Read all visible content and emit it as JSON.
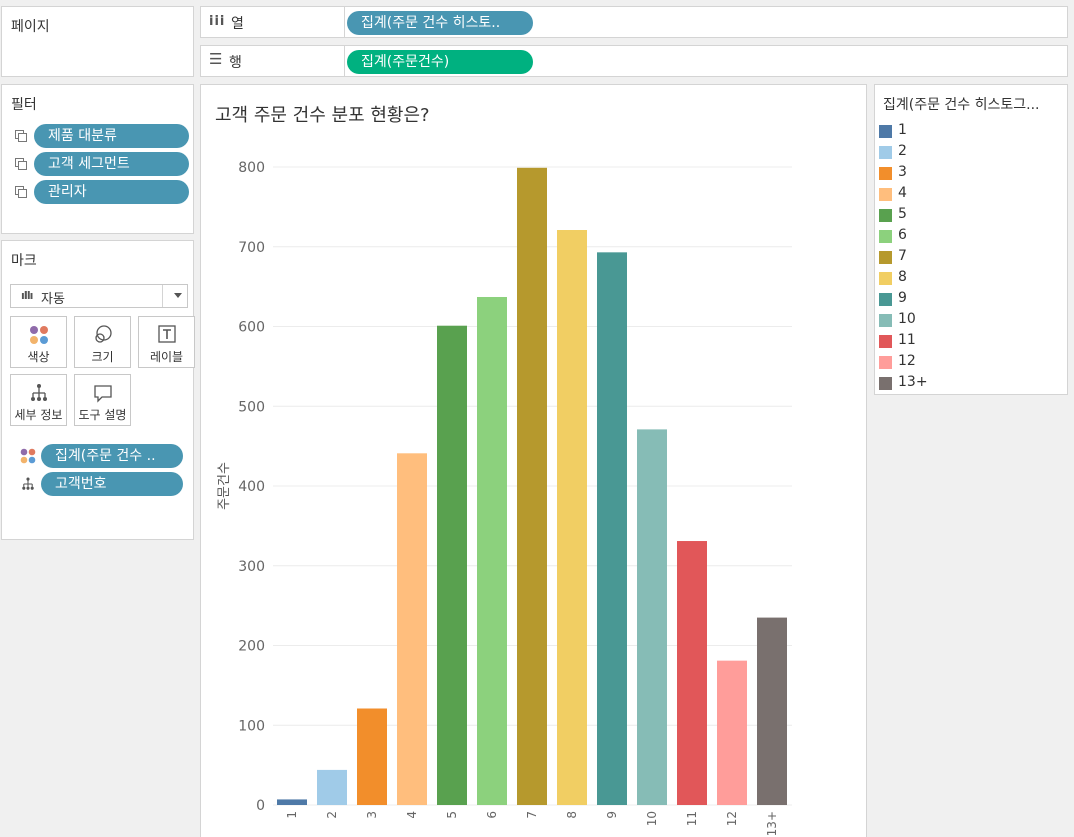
{
  "pages_shelf": {
    "title": "페이지"
  },
  "columns_shelf": {
    "label": "열",
    "pill": "집계(주문 건수 히스토.."
  },
  "rows_shelf": {
    "label": "행",
    "pill": "집계(주문건수)"
  },
  "filters": {
    "title": "필터",
    "items": [
      "제품 대분류",
      "고객 세그먼트",
      "관리자"
    ]
  },
  "marks": {
    "title": "마크",
    "type": "자동",
    "buttons": {
      "color": "색상",
      "size": "크기",
      "label": "레이블",
      "detail": "세부 정보",
      "tooltip": "도구 설명"
    },
    "fields": [
      "집계(주문 건수 ..",
      "고객번호"
    ]
  },
  "legend": {
    "title": "집계(주문 건수 히스토그...",
    "items": [
      {
        "label": "1",
        "color": "#4e79a7"
      },
      {
        "label": "2",
        "color": "#a0cbe8"
      },
      {
        "label": "3",
        "color": "#f28e2b"
      },
      {
        "label": "4",
        "color": "#ffbe7d"
      },
      {
        "label": "5",
        "color": "#59a14f"
      },
      {
        "label": "6",
        "color": "#8cd17d"
      },
      {
        "label": "7",
        "color": "#b6992d"
      },
      {
        "label": "8",
        "color": "#f1ce63"
      },
      {
        "label": "9",
        "color": "#499894"
      },
      {
        "label": "10",
        "color": "#86bcb6"
      },
      {
        "label": "11",
        "color": "#e15759"
      },
      {
        "label": "12",
        "color": "#ff9d9a"
      },
      {
        "label": "13+",
        "color": "#79706e"
      }
    ]
  },
  "chart_data": {
    "type": "bar",
    "title": "고객 주문 건수 분포 현황은?",
    "xlabel": "",
    "ylabel": "주문건수",
    "categories": [
      "1",
      "2",
      "3",
      "4",
      "5",
      "6",
      "7",
      "8",
      "9",
      "10",
      "11",
      "12",
      "13+"
    ],
    "values": [
      7,
      44,
      121,
      441,
      601,
      637,
      799,
      721,
      693,
      471,
      331,
      181,
      235
    ],
    "colors": [
      "#4e79a7",
      "#a0cbe8",
      "#f28e2b",
      "#ffbe7d",
      "#59a14f",
      "#8cd17d",
      "#b6992d",
      "#f1ce63",
      "#499894",
      "#86bcb6",
      "#e15759",
      "#ff9d9a",
      "#79706e"
    ],
    "yticks": [
      0,
      100,
      200,
      300,
      400,
      500,
      600,
      700,
      800
    ],
    "ylim": [
      0,
      800
    ],
    "grid": true,
    "legend": "right"
  }
}
